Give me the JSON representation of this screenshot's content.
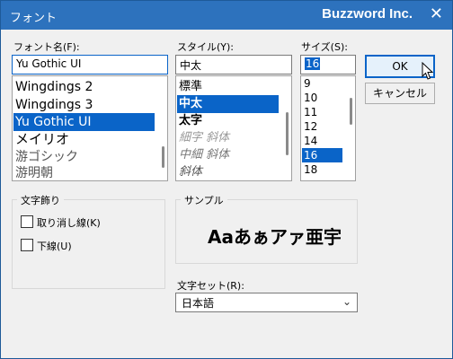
{
  "window": {
    "title": "フォント",
    "brand": "Buzzword Inc.",
    "close_symbol": "✕"
  },
  "font": {
    "label": "フォント名(F):",
    "value": "Yu Gothic UI",
    "items": [
      {
        "label": "Wingdings 2",
        "selected": false
      },
      {
        "label": "Wingdings 3",
        "selected": false
      },
      {
        "label": "Yu Gothic UI",
        "selected": true
      },
      {
        "label": "メイリオ",
        "selected": false
      },
      {
        "label": "游ゴシック",
        "selected": false
      },
      {
        "label": "游明朝",
        "selected": false
      }
    ]
  },
  "style": {
    "label": "スタイル(Y):",
    "value": "中太",
    "items": [
      {
        "label": "標準",
        "selected": false
      },
      {
        "label": "中太",
        "selected": true
      },
      {
        "label": "太字",
        "selected": false
      },
      {
        "label": "細字 斜体",
        "selected": false
      },
      {
        "label": "中細 斜体",
        "selected": false
      },
      {
        "label": "斜体",
        "selected": false
      }
    ]
  },
  "size": {
    "label": "サイズ(S):",
    "value": "16",
    "items": [
      {
        "label": "9",
        "selected": false
      },
      {
        "label": "10",
        "selected": false
      },
      {
        "label": "11",
        "selected": false
      },
      {
        "label": "12",
        "selected": false
      },
      {
        "label": "14",
        "selected": false
      },
      {
        "label": "16",
        "selected": true
      },
      {
        "label": "18",
        "selected": false
      }
    ]
  },
  "buttons": {
    "ok": "OK",
    "cancel": "キャンセル"
  },
  "effects": {
    "label": "文字飾り",
    "strike": "取り消し線(K)",
    "underline": "下線(U)"
  },
  "sample": {
    "label": "サンプル",
    "text": "Aaあぁアァ亜宇"
  },
  "charset": {
    "label": "文字セット(R):",
    "value": "日本語"
  }
}
